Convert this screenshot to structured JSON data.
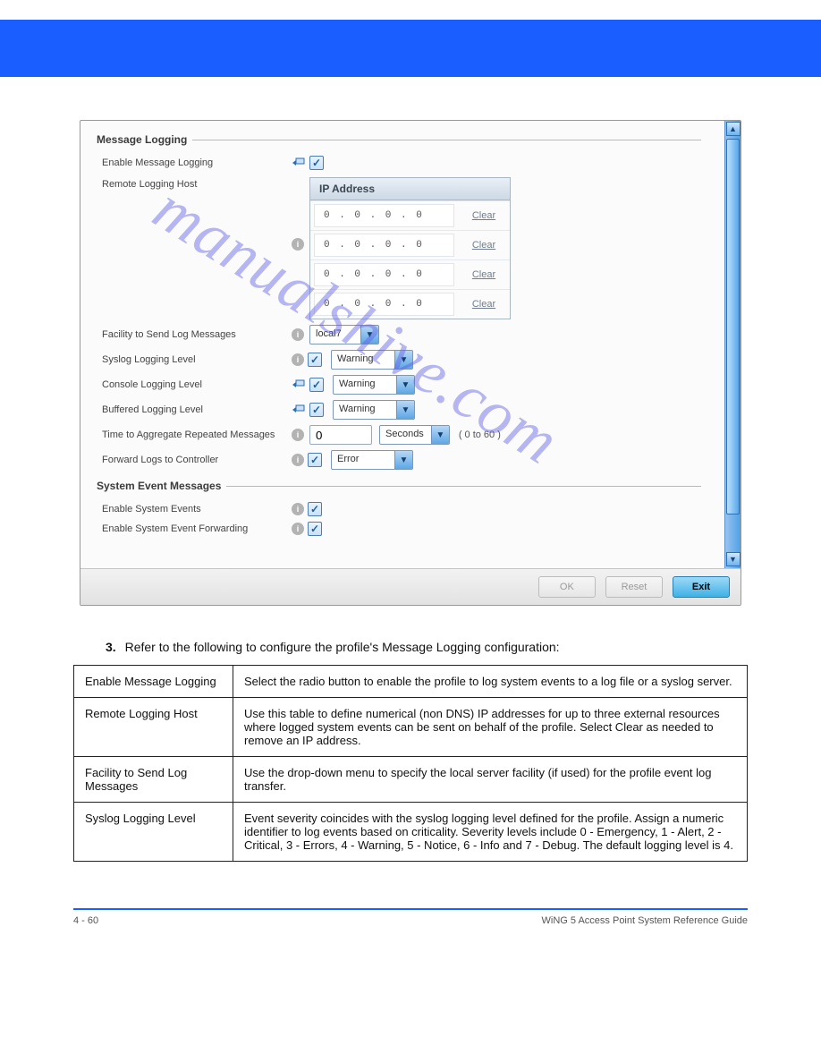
{
  "watermark": "manualshive.com",
  "panel": {
    "section1_title": "Message Logging",
    "section2_title": "System Event Messages",
    "fields": {
      "enable_msg_logging": {
        "label": "Enable Message Logging",
        "checked": true
      },
      "remote_host": {
        "label": "Remote Logging Host",
        "header": "IP Address",
        "rows": [
          {
            "ip": "0 . 0 . 0 . 0",
            "clear": "Clear"
          },
          {
            "ip": "0 . 0 . 0 . 0",
            "clear": "Clear"
          },
          {
            "ip": "0 . 0 . 0 . 0",
            "clear": "Clear"
          },
          {
            "ip": "0 . 0 . 0 . 0",
            "clear": "Clear"
          }
        ]
      },
      "facility": {
        "label": "Facility to Send Log Messages",
        "value": "local7"
      },
      "syslog_level": {
        "label": "Syslog Logging Level",
        "value": "Warning",
        "checked": true
      },
      "console_level": {
        "label": "Console Logging Level",
        "value": "Warning",
        "checked": true
      },
      "buffered_level": {
        "label": "Buffered Logging Level",
        "value": "Warning",
        "checked": true
      },
      "aggregate": {
        "label": "Time to Aggregate Repeated Messages",
        "value": "0",
        "unit": "Seconds",
        "range": "( 0 to 60 )"
      },
      "forward_ctrl": {
        "label": "Forward Logs to Controller",
        "value": "Error",
        "checked": true
      },
      "enable_sys_events": {
        "label": "Enable System Events",
        "checked": true
      },
      "enable_sys_fwd": {
        "label": "Enable System Event Forwarding",
        "checked": true
      }
    },
    "buttons": {
      "ok": "OK",
      "reset": "Reset",
      "exit": "Exit"
    }
  },
  "doc": {
    "step_no": "3.",
    "step_text": "Refer to the following to configure the profile's Message Logging configuration:",
    "rows": [
      {
        "left": "Enable Message Logging",
        "right": "Select the radio button to enable the profile to log system events to a log file or a syslog server."
      },
      {
        "left": "Remote Logging Host",
        "right": "Use this table to define numerical (non DNS) IP addresses for up to three external resources where logged system events can be sent on behalf of the profile. Select Clear as needed to remove an IP address."
      },
      {
        "left": "Facility to Send Log Messages",
        "right": "Use the drop-down menu to specify the local server facility (if used) for the profile event log transfer."
      },
      {
        "left": "Syslog Logging Level",
        "right": "Event severity coincides with the syslog logging level defined for the profile. Assign a numeric identifier to log events based on criticality. Severity levels include 0 - Emergency, 1 - Alert, 2 - Critical, 3 - Errors, 4 - Warning, 5 - Notice, 6 - Info and 7 - Debug. The default logging level is 4."
      }
    ]
  },
  "footer": {
    "left": "4 - 60",
    "right": "WiNG 5 Access Point System Reference Guide"
  }
}
